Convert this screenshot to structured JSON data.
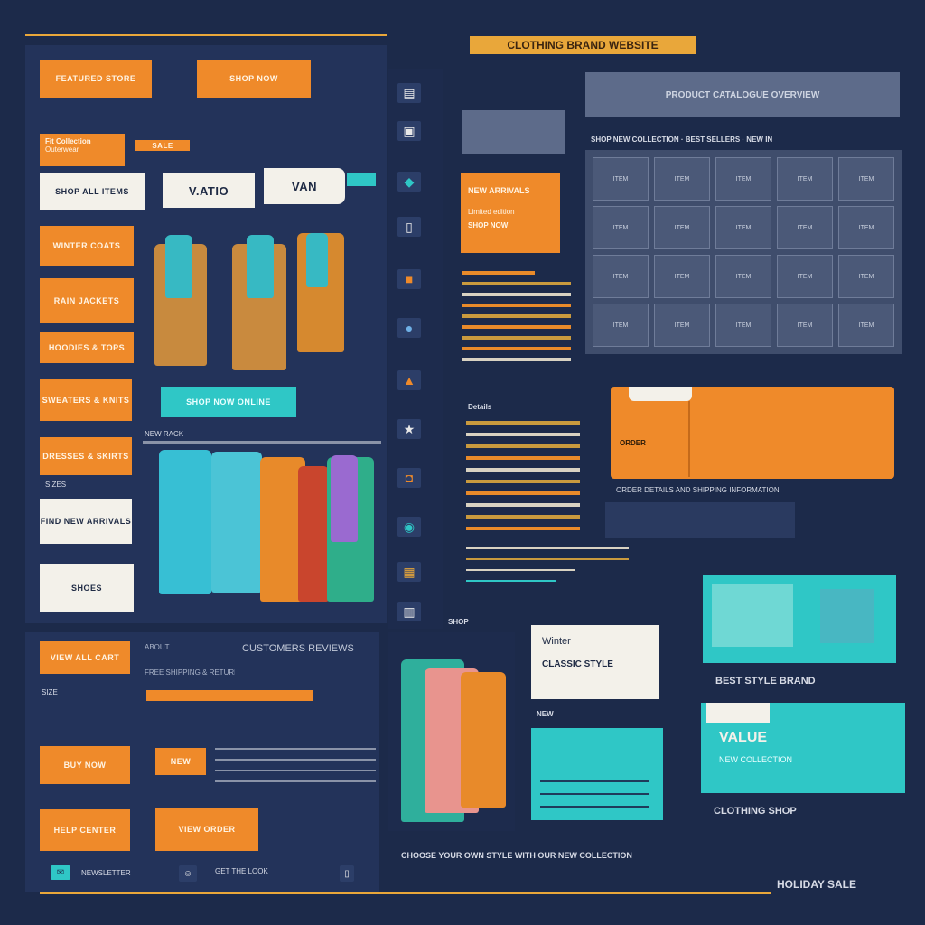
{
  "header": {
    "title": "CLOTHING BRAND WEBSITE",
    "topline_label": ""
  },
  "left_panel": {
    "tab_one": "FEATURED STORE",
    "tab_two": "SHOP NOW",
    "category_title": "Fit Collection",
    "category_sub": "Outerwear",
    "sort_badge": "SALE",
    "menu": [
      "WINTER COATS",
      "RAIN JACKETS",
      "HOODIES & TOPS",
      "SWEATERS & KNITS",
      "DRESSES & SKIRTS",
      "SHOES"
    ],
    "filter_label": "SIZES",
    "search_box_a": "Shop all items",
    "search_box_b": "Find new arrivals",
    "pill_one": "V.ATIO",
    "pill_two": "VAN",
    "shop_button": "SHOP NOW ONLINE",
    "rack_title": "NEW RACK"
  },
  "bottom_left": {
    "label_a": "VIEW ALL CART",
    "label_b": "ABOUT",
    "label_c": "BUY NOW",
    "label_d": "HELP CENTER",
    "label_e": "NEW",
    "label_f": "VIEW ORDER",
    "input_caption": "SIZE",
    "footer_left": "NEWSLETTER",
    "footer_mid": "GET THE LOOK",
    "desc_one": "CUSTOMERS REVIEWS",
    "desc_two": "FREE SHIPPING & RETURNS"
  },
  "middle": {
    "promo_title": "NEW ARRIVALS",
    "promo_sub": "Limited edition",
    "promo_cta": "SHOP NOW",
    "section_label": "Details",
    "cart_heading": "SHOP",
    "card_title": "Winter",
    "card_sub": "CLASSIC STYLE",
    "footer_caption": "CHOOSE YOUR OWN STYLE WITH OUR NEW COLLECTION"
  },
  "right": {
    "grid_header": "PRODUCT CATALOGUE OVERVIEW",
    "grid_sub": "SHOP NEW COLLECTION · BEST SELLERS · NEW IN",
    "grid_cells": [
      "ITEM",
      "ITEM",
      "ITEM",
      "ITEM",
      "ITEM",
      "ITEM",
      "ITEM",
      "ITEM",
      "ITEM",
      "ITEM",
      "ITEM",
      "ITEM",
      "ITEM",
      "ITEM",
      "ITEM",
      "ITEM",
      "ITEM",
      "ITEM",
      "ITEM",
      "ITEM"
    ],
    "wallet_label": "ORDER",
    "wallet_caption": "ORDER DETAILS AND SHIPPING INFORMATION",
    "teal_caption": "NEW COLLECTION",
    "teal_big": "VALUE",
    "caption_one": "BEST STYLE BRAND",
    "caption_two": "CLOTHING SHOP",
    "footer_right": "HOLIDAY SALE"
  },
  "colors": {
    "accent_orange": "#ef8a2a",
    "accent_teal": "#2fc7c6",
    "background": "#1c2a4a",
    "panel": "#23335a"
  }
}
